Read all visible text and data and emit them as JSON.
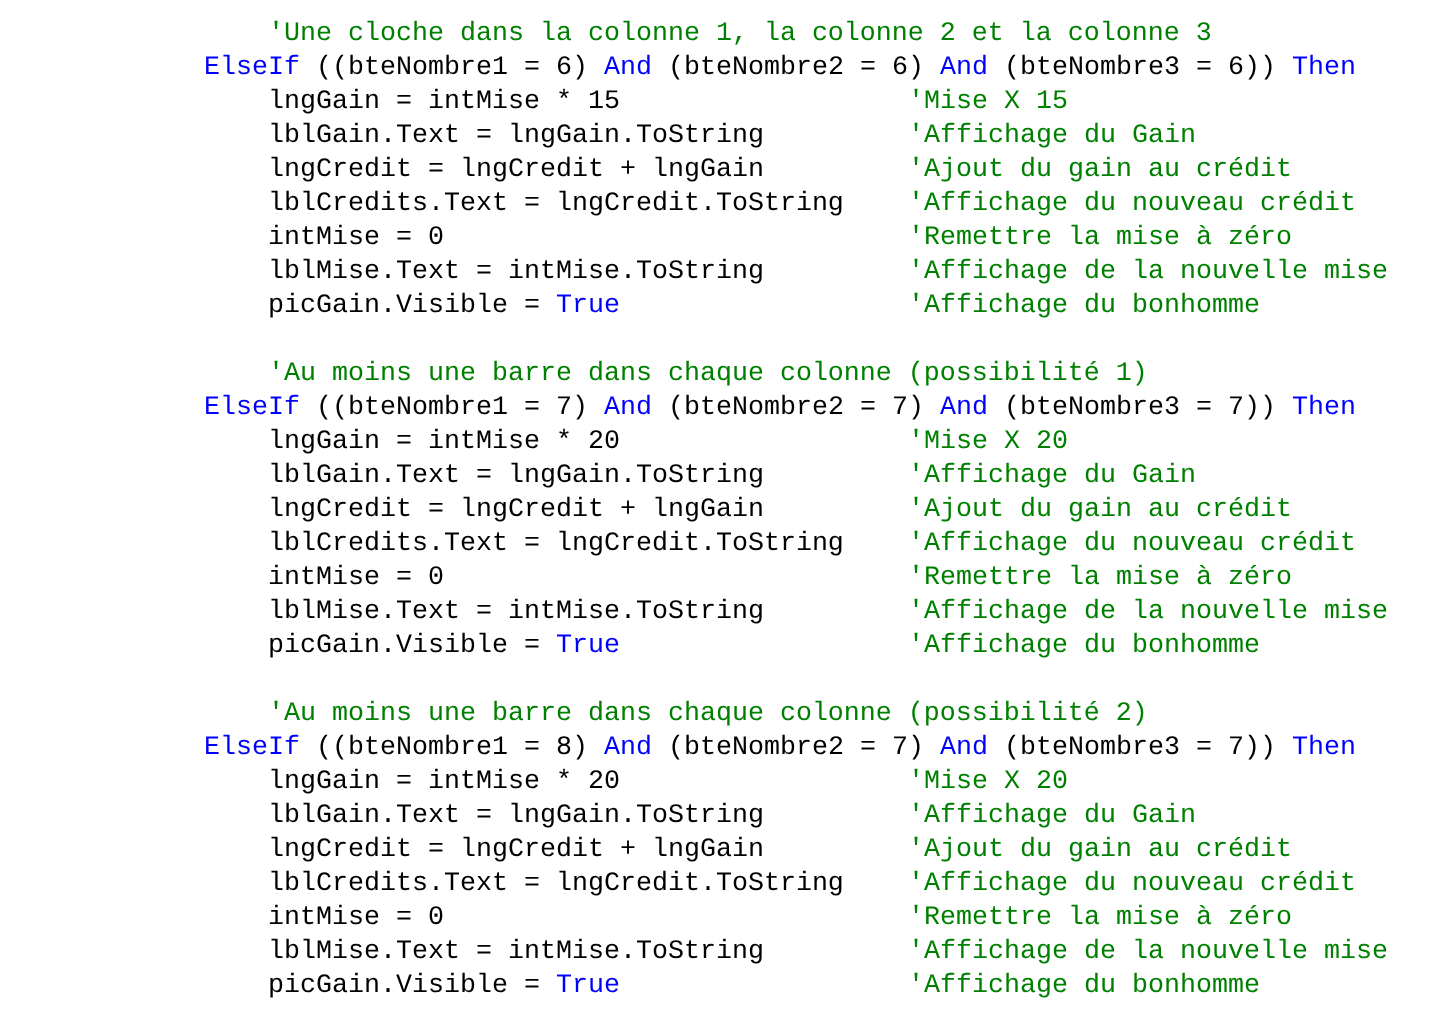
{
  "blocks": [
    {
      "comment": "'Une cloche dans la colonne 1, la colonne 2 et la colonne 3",
      "condition": [
        {
          "kind": "keyword",
          "text": "ElseIf"
        },
        {
          "kind": "code",
          "text": "((bteNombre1 = 6)"
        },
        {
          "kind": "keyword",
          "text": "And"
        },
        {
          "kind": "code",
          "text": "(bteNombre2 = 6)"
        },
        {
          "kind": "keyword",
          "text": "And"
        },
        {
          "kind": "code",
          "text": "(bteNombre3 = 6))"
        },
        {
          "kind": "keyword",
          "text": "Then"
        }
      ],
      "statements": [
        {
          "code": [
            {
              "kind": "code",
              "text": "lngGain = intMise * 15"
            }
          ],
          "comment": "'Mise X 15"
        },
        {
          "code": [
            {
              "kind": "code",
              "text": "lblGain.Text = lngGain.ToString"
            }
          ],
          "comment": "'Affichage du Gain"
        },
        {
          "code": [
            {
              "kind": "code",
              "text": "lngCredit = lngCredit + lngGain"
            }
          ],
          "comment": "'Ajout du gain au crédit"
        },
        {
          "code": [
            {
              "kind": "code",
              "text": "lblCredits.Text = lngCredit.ToString"
            }
          ],
          "comment": "'Affichage du nouveau crédit"
        },
        {
          "code": [
            {
              "kind": "code",
              "text": "intMise = 0"
            }
          ],
          "comment": "'Remettre la mise à zéro"
        },
        {
          "code": [
            {
              "kind": "code",
              "text": "lblMise.Text = intMise.ToString"
            }
          ],
          "comment": "'Affichage de la nouvelle mise"
        },
        {
          "code": [
            {
              "kind": "code",
              "text": "picGain.Visible ="
            },
            {
              "kind": "keyword",
              "text": "True"
            }
          ],
          "comment": "'Affichage du bonhomme"
        }
      ]
    },
    {
      "comment": "'Au moins une barre dans chaque colonne (possibilité 1)",
      "condition": [
        {
          "kind": "keyword",
          "text": "ElseIf"
        },
        {
          "kind": "code",
          "text": "((bteNombre1 = 7)"
        },
        {
          "kind": "keyword",
          "text": "And"
        },
        {
          "kind": "code",
          "text": "(bteNombre2 = 7)"
        },
        {
          "kind": "keyword",
          "text": "And"
        },
        {
          "kind": "code",
          "text": "(bteNombre3 = 7))"
        },
        {
          "kind": "keyword",
          "text": "Then"
        }
      ],
      "statements": [
        {
          "code": [
            {
              "kind": "code",
              "text": "lngGain = intMise * 20"
            }
          ],
          "comment": "'Mise X 20"
        },
        {
          "code": [
            {
              "kind": "code",
              "text": "lblGain.Text = lngGain.ToString"
            }
          ],
          "comment": "'Affichage du Gain"
        },
        {
          "code": [
            {
              "kind": "code",
              "text": "lngCredit = lngCredit + lngGain"
            }
          ],
          "comment": "'Ajout du gain au crédit"
        },
        {
          "code": [
            {
              "kind": "code",
              "text": "lblCredits.Text = lngCredit.ToString"
            }
          ],
          "comment": "'Affichage du nouveau crédit"
        },
        {
          "code": [
            {
              "kind": "code",
              "text": "intMise = 0"
            }
          ],
          "comment": "'Remettre la mise à zéro"
        },
        {
          "code": [
            {
              "kind": "code",
              "text": "lblMise.Text = intMise.ToString"
            }
          ],
          "comment": "'Affichage de la nouvelle mise"
        },
        {
          "code": [
            {
              "kind": "code",
              "text": "picGain.Visible ="
            },
            {
              "kind": "keyword",
              "text": "True"
            }
          ],
          "comment": "'Affichage du bonhomme"
        }
      ]
    },
    {
      "comment": "'Au moins une barre dans chaque colonne (possibilité 2)",
      "condition": [
        {
          "kind": "keyword",
          "text": "ElseIf"
        },
        {
          "kind": "code",
          "text": "((bteNombre1 = 8)"
        },
        {
          "kind": "keyword",
          "text": "And"
        },
        {
          "kind": "code",
          "text": "(bteNombre2 = 7)"
        },
        {
          "kind": "keyword",
          "text": "And"
        },
        {
          "kind": "code",
          "text": "(bteNombre3 = 7))"
        },
        {
          "kind": "keyword",
          "text": "Then"
        }
      ],
      "statements": [
        {
          "code": [
            {
              "kind": "code",
              "text": "lngGain = intMise * 20"
            }
          ],
          "comment": "'Mise X 20"
        },
        {
          "code": [
            {
              "kind": "code",
              "text": "lblGain.Text = lngGain.ToString"
            }
          ],
          "comment": "'Affichage du Gain"
        },
        {
          "code": [
            {
              "kind": "code",
              "text": "lngCredit = lngCredit + lngGain"
            }
          ],
          "comment": "'Ajout du gain au crédit"
        },
        {
          "code": [
            {
              "kind": "code",
              "text": "lblCredits.Text = lngCredit.ToString"
            }
          ],
          "comment": "'Affichage du nouveau crédit"
        },
        {
          "code": [
            {
              "kind": "code",
              "text": "intMise = 0"
            }
          ],
          "comment": "'Remettre la mise à zéro"
        },
        {
          "code": [
            {
              "kind": "code",
              "text": "lblMise.Text = intMise.ToString"
            }
          ],
          "comment": "'Affichage de la nouvelle mise"
        },
        {
          "code": [
            {
              "kind": "code",
              "text": "picGain.Visible ="
            },
            {
              "kind": "keyword",
              "text": "True"
            }
          ],
          "comment": "'Affichage du bonhomme"
        }
      ]
    }
  ]
}
